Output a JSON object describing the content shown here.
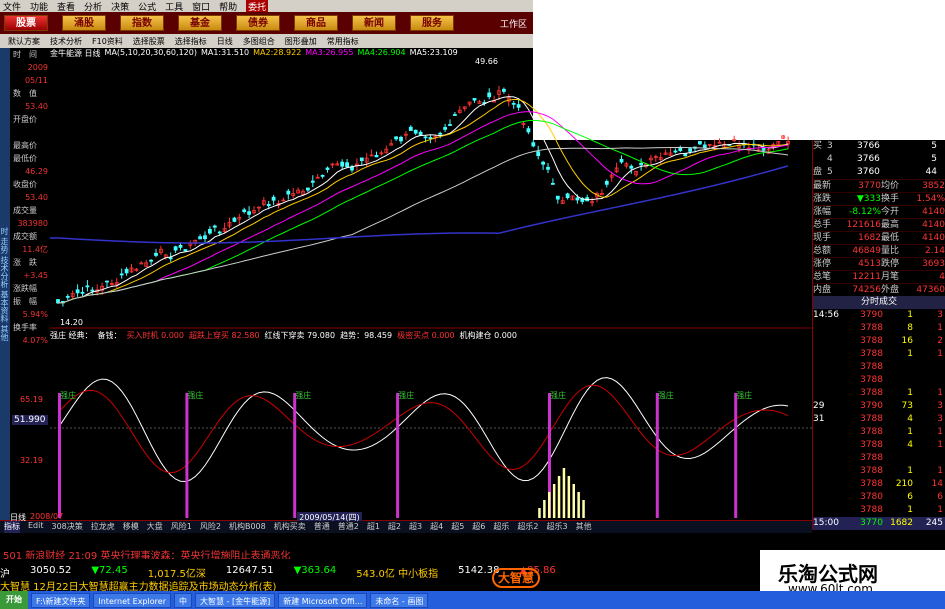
{
  "menu": [
    "文件",
    "功能",
    "查看",
    "分析",
    "决策",
    "公式",
    "工具",
    "窗口",
    "帮助",
    "委托"
  ],
  "nav": [
    "股票",
    "涌股",
    "指数",
    "基金",
    "债券",
    "商品",
    "新闻",
    "服务"
  ],
  "workarea": "工作区",
  "toolbar": [
    "默认方案",
    "技术分析",
    "F10资料",
    "选择股票",
    "选择指标",
    "日线",
    "多图组合",
    "图形叠加",
    "常用指标"
  ],
  "side_tabs": "时 走势 技术分析 基本资料 其他",
  "left": [
    {
      "l": "时　间",
      "v": ""
    },
    {
      "l": "",
      "v": "2009"
    },
    {
      "l": "",
      "v": "05/11"
    },
    {
      "l": "数　值",
      "v": ""
    },
    {
      "l": "",
      "v": "53.40"
    },
    {
      "l": "开盘价",
      "v": ""
    },
    {
      "l": "",
      "v": ""
    },
    {
      "l": "最高价",
      "v": ""
    },
    {
      "l": "最低价",
      "v": ""
    },
    {
      "l": "",
      "v": "46.29"
    },
    {
      "l": "收盘价",
      "v": ""
    },
    {
      "l": "",
      "v": "53.40"
    },
    {
      "l": "成交量",
      "v": ""
    },
    {
      "l": "",
      "v": "383980"
    },
    {
      "l": "成交额",
      "v": ""
    },
    {
      "l": "",
      "v": "11.4亿"
    },
    {
      "l": "涨　跌",
      "v": ""
    },
    {
      "l": "",
      "v": "+3.45"
    },
    {
      "l": "涨跌幅",
      "v": ""
    },
    {
      "l": "振　幅",
      "v": ""
    },
    {
      "l": "",
      "v": "5.94%"
    },
    {
      "l": "换手率",
      "v": ""
    },
    {
      "l": "",
      "v": "4.07%"
    }
  ],
  "title": {
    "name": "金牛能源 日线",
    "ma": "MA(5,10,20,30,60,120)",
    "ma1": "MA1:31.510",
    "ma2": "MA2:28.922",
    "ma3": "MA3:26.955",
    "ma4": "MA4:26.904",
    "ma5": "MA5:23.109",
    "peak": "49.66",
    "low": "14.20"
  },
  "indicator": {
    "a": "强庄 经典：",
    "b": "备钱：",
    "c": "买入时机 0.000",
    "d": "超跌上穿买 82.580",
    "e": "红线下穿卖 79.080",
    "f": "趋势：98.459",
    "g": "极密买点 0.000",
    "h": "机构建仓 0.000",
    "lv1": "65.19",
    "lv2": "51.990",
    "lv3": "32.19",
    "tag": "强庄"
  },
  "date_label": "2009/05/14(四)",
  "period_label": "日线",
  "year_label": "2008/07",
  "bottom_tabs": [
    "指标",
    "Edit",
    "308决策",
    "拉龙虎",
    "移模",
    "大盘",
    "风险1",
    "风险2",
    "机构B008",
    "机构买卖",
    "普通",
    "普通2",
    "超1",
    "超2",
    "超3",
    "超4",
    "超5",
    "超6",
    "超乐",
    "超乐2",
    "超乐3",
    "其他"
  ],
  "right": {
    "book": [
      [
        "买",
        "3",
        "3766",
        "5"
      ],
      [
        "",
        "4",
        "3766",
        "5"
      ],
      [
        "",
        "5",
        "3760",
        "44"
      ]
    ],
    "book_prefix": [
      "",
      "",
      "盘"
    ],
    "quote": [
      [
        "最新",
        "3770",
        "均价",
        "3852"
      ],
      [
        "涨跌",
        "▼333",
        "换手",
        "1.54%"
      ],
      [
        "涨幅",
        "-8.12%",
        "今开",
        "4140"
      ],
      [
        "总手",
        "121616",
        "最高",
        "4140"
      ],
      [
        "现手",
        "1682",
        "最低",
        "4140"
      ],
      [
        "总额",
        "46849",
        "量比",
        "2.14"
      ],
      [
        "涨停",
        "4513",
        "跌停",
        "3693"
      ],
      [
        "总笔",
        "12211",
        "月笔",
        "4"
      ],
      [
        "内盘",
        "74256",
        "外盘",
        "47360"
      ]
    ],
    "tab": "分时成交",
    "trades": [
      [
        "14:56",
        "3790",
        "1",
        "3"
      ],
      [
        "",
        "3788",
        "8",
        "1"
      ],
      [
        "",
        "3788",
        "16",
        "2"
      ],
      [
        "",
        "3788",
        "1",
        "1"
      ],
      [
        "",
        "3788",
        "",
        ""
      ],
      [
        "",
        "3788",
        "",
        ""
      ],
      [
        "",
        "3788",
        "1",
        "1"
      ],
      [
        "29",
        "3790",
        "73",
        "3"
      ],
      [
        "31",
        "3788",
        "4",
        "3"
      ],
      [
        "",
        "3788",
        "1",
        "1"
      ],
      [
        "",
        "3788",
        "4",
        "1"
      ],
      [
        "",
        "3788",
        "",
        ""
      ],
      [
        "",
        "3788",
        "1",
        "1"
      ],
      [
        "",
        "3788",
        "210",
        "14"
      ],
      [
        "",
        "3780",
        "6",
        "6"
      ],
      [
        "",
        "3788",
        "1",
        "1"
      ]
    ],
    "last": [
      "15:00",
      "3770",
      "1682",
      "245"
    ]
  },
  "news": "501 新浪财经 21:09 英央行理事波森：英央行增施阻止表通恶化",
  "ticker": {
    "hu": "沪",
    "v1": "3050.52",
    "v2": "▼72.45",
    "v3": "1,017.5亿深",
    "v4": "12647.51",
    "v5": "▼363.64",
    "v6": "543.0亿 中小板指",
    "v7": "5142.38",
    "v8": "▲95.86"
  },
  "scroll": "大智慧  12月22日大智慧超赢主力数据追踪及市场动态分析(表)",
  "watermark": {
    "cn": "乐淘公式网",
    "url": "www.60lt.com"
  },
  "logo": "大智慧",
  "taskbar": {
    "start": "开始",
    "tasks": [
      "F:\\新建文件夹",
      "Internet Explorer",
      "大智慧 - [金牛能源]",
      "新建 Microsoft Offi...",
      "未命名 - 画图"
    ],
    "mid": "中"
  }
}
